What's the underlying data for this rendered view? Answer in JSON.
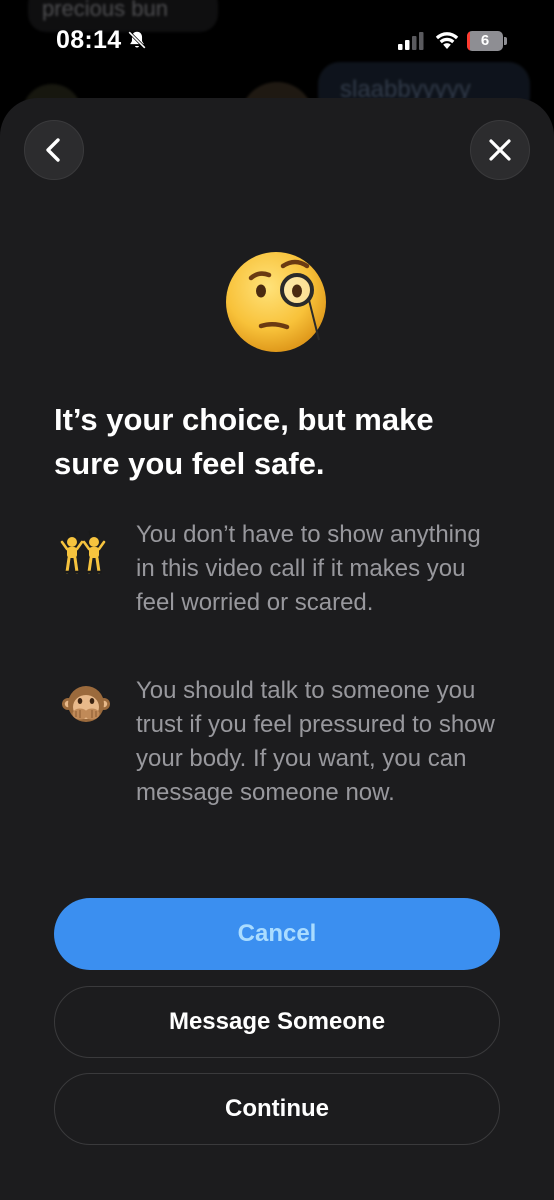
{
  "background_chat": {
    "top_message": "precious bun",
    "right_message": "slaabbyyyyy"
  },
  "status_bar": {
    "time": "08:14",
    "battery_level": "6",
    "battery_color": "#ff3b30"
  },
  "sheet": {
    "back_icon": "chevron-left-icon",
    "close_icon": "close-icon",
    "hero_icon": "face-with-monocle-emoji",
    "heading": "It’s your choice, but make sure you feel safe.",
    "items": [
      {
        "icon": "people-with-bunny-ears-emoji",
        "text": "You don’t have to show anything in this video call if it makes you feel worried or scared."
      },
      {
        "icon": "speak-no-evil-monkey-emoji",
        "text": "You should talk to someone you trust if you feel pressured to show your body. If you want, you can message someone now."
      }
    ],
    "buttons": {
      "cancel": "Cancel",
      "message": "Message Someone",
      "continue": "Continue"
    }
  },
  "colors": {
    "sheet_background": "#1c1c1e",
    "accent_blue": "#3b8ff0",
    "secondary_text": "#98989d"
  }
}
